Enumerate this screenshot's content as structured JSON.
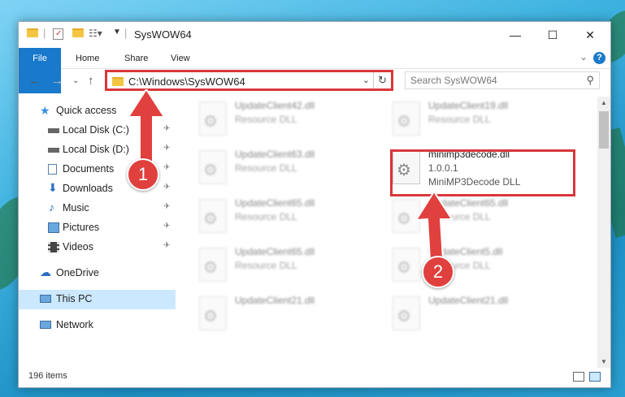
{
  "window": {
    "title": "SysWOW64",
    "controls": {
      "minimize": "—",
      "maximize": "☐",
      "close": "✕"
    }
  },
  "ribbon": {
    "tabs": [
      "File",
      "Home",
      "Share",
      "View"
    ],
    "help": "?"
  },
  "navbar": {
    "address": "C:\\Windows\\SysWOW64",
    "search_placeholder": "Search SysWOW64"
  },
  "sidebar": {
    "items": [
      {
        "label": "Quick access",
        "icon": "star-icon"
      },
      {
        "label": "Local Disk (C:)",
        "icon": "drive-icon",
        "pinned": true
      },
      {
        "label": "Local Disk (D:)",
        "icon": "drive-icon",
        "pinned": true
      },
      {
        "label": "Documents",
        "icon": "documents-icon",
        "pinned": true
      },
      {
        "label": "Downloads",
        "icon": "downloads-icon",
        "pinned": true
      },
      {
        "label": "Music",
        "icon": "music-icon",
        "pinned": true
      },
      {
        "label": "Pictures",
        "icon": "pictures-icon",
        "pinned": true
      },
      {
        "label": "Videos",
        "icon": "videos-icon",
        "pinned": true
      },
      {
        "label": "OneDrive",
        "icon": "cloud-icon"
      },
      {
        "label": "This PC",
        "icon": "computer-icon",
        "selected": true
      },
      {
        "label": "Network",
        "icon": "network-icon"
      }
    ]
  },
  "files": [
    {
      "name": "UpdateClient42.dll",
      "type": "Resource DLL"
    },
    {
      "name": "UpdateClient19.dll",
      "type": "Resource DLL"
    },
    {
      "name": "UpdateClient63.dll",
      "type": "Resource DLL"
    },
    {
      "name": "minimp3decode.dll",
      "version": "1.0.0.1",
      "description": "MiniMP3Decode DLL"
    },
    {
      "name": "UpdateClient65.dll",
      "type": "Resource DLL"
    },
    {
      "name": "UpdateClient65.dll",
      "type": "Resource DLL"
    },
    {
      "name": "UpdateClient65.dll",
      "type": "Resource DLL"
    },
    {
      "name": "UpdateClient5.dll",
      "type": "Resource DLL"
    },
    {
      "name": "UpdateClient21.dll",
      "type": "Resource DLL"
    },
    {
      "name": "UpdateClient21.dll",
      "type": "Resource DLL"
    }
  ],
  "status": {
    "count": "196 items"
  },
  "annotations": {
    "step1": "1",
    "step2": "2"
  },
  "colors": {
    "accent": "#1979ca",
    "highlight": "#d9373b",
    "selection": "#cce8ff"
  }
}
